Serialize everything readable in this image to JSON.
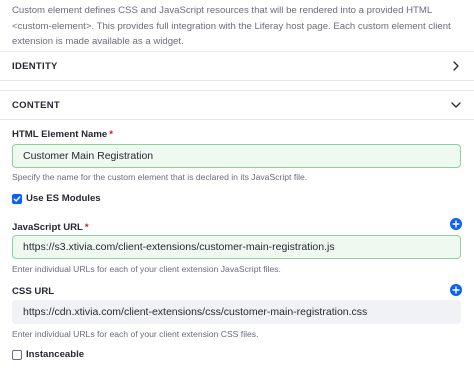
{
  "intro": {
    "line1": "Custom element defines CSS and JavaScript resources that will be rendered into a provided HTML",
    "line2": "<custom-element>. This provides full integration with the Liferay host page. Each custom element client",
    "line3": "extension is made available as a widget."
  },
  "sections": {
    "identity": {
      "title": "IDENTITY",
      "icon": "chevron-right-icon"
    },
    "content": {
      "title": "CONTENT",
      "icon": "chevron-down-icon"
    }
  },
  "html_element_name": {
    "label": "HTML Element Name",
    "required_mark": "*",
    "value": "Customer Main Registration",
    "help": "Specify the name for the custom element that is declared in its JavaScript file."
  },
  "use_es_modules": {
    "label": "Use ES Modules",
    "checked": true
  },
  "javascript_url": {
    "label": "JavaScript URL",
    "required_mark": "*",
    "value": "https://s3.xtivia.com/client-extensions/customer-main-registration.js",
    "help": "Enter individual URLs for each of your client extension JavaScript files.",
    "add_icon": "plus-icon"
  },
  "css_url": {
    "label": "CSS URL",
    "value": "https://cdn.xtivia.com/client-extensions/css/customer-main-registration.css",
    "help": "Enter individual URLs for each of your client extension CSS files.",
    "add_icon": "plus-icon"
  },
  "instanceable": {
    "label": "Instanceable",
    "checked": false
  },
  "colors": {
    "accent": "#0b5fff",
    "valid_border": "#8fd19e",
    "valid_bg": "#eef9f0",
    "required": "#da1414",
    "secondary_text": "#6b6c7e"
  }
}
